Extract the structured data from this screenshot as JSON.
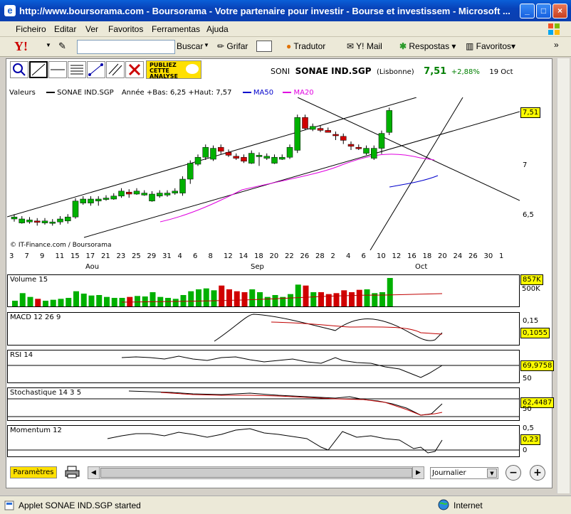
{
  "window": {
    "title": "http://www.boursorama.com - Boursorama - Votre partenaire pour investir - Bourse et investissem - Microsoft ..."
  },
  "menu": [
    "Ficheiro",
    "Editar",
    "Ver",
    "Favoritos",
    "Ferramentas",
    "Ajuda"
  ],
  "toolbar": {
    "search_label": "Buscar",
    "highlight_label": "Grifar",
    "translator_label": "Tradutor",
    "mail_label": "Y! Mail",
    "answers_label": "Respostas",
    "favorites_label": "Favoritos"
  },
  "ad": {
    "line1": "PUBLIEZ",
    "line2": "CETTE",
    "line3": "ANALYSE"
  },
  "quote": {
    "code": "SONI",
    "name": "SONAE IND.SGP",
    "market": "(Lisbonne)",
    "price": "7,51",
    "change": "+2,88%",
    "date": "19 Oct"
  },
  "chart": {
    "header": {
      "values_label": "Valeurs",
      "series_name": "SONAE IND.SGP",
      "range_text": "Année +Bas: 6,25 +Haut: 7,57",
      "ma50": "MA50",
      "ma20": "MA20"
    },
    "credit": "© IT-Finance.com / Boursorama",
    "price_labels": [
      "7,5",
      "7",
      "6,5"
    ],
    "last_price": "7,51",
    "x_days": [
      "3",
      "7",
      "9",
      "11",
      "15",
      "17",
      "21",
      "23",
      "25",
      "29",
      "31",
      "4",
      "6",
      "8",
      "12",
      "14",
      "18",
      "20",
      "22",
      "26",
      "28",
      "2",
      "4",
      "6",
      "10",
      "12",
      "16",
      "18",
      "20",
      "24",
      "26",
      "30",
      "1"
    ],
    "months": [
      "Aou",
      "Sep",
      "Oct"
    ],
    "colors": {
      "up": "#00b000",
      "down": "#d00000",
      "ma50": "#0000cc",
      "ma20": "#e000e0",
      "highlight": "#ffff00"
    },
    "candles": [
      [
        6.42,
        6.44,
        6.4
      ],
      [
        6.38,
        6.42,
        6.38
      ],
      [
        6.39,
        6.41,
        6.38
      ],
      [
        6.4,
        6.39,
        6.36
      ],
      [
        6.38,
        6.4,
        6.37
      ],
      [
        6.39,
        6.39,
        6.36
      ],
      [
        6.39,
        6.42,
        6.37
      ],
      [
        6.4,
        6.44,
        6.38
      ],
      [
        6.44,
        6.6,
        6.43
      ],
      [
        6.58,
        6.62,
        6.57
      ],
      [
        6.58,
        6.62,
        6.56
      ],
      [
        6.6,
        6.62,
        6.56
      ],
      [
        6.62,
        6.63,
        6.61
      ],
      [
        6.62,
        6.65,
        6.62
      ],
      [
        6.65,
        6.7,
        6.64
      ],
      [
        6.69,
        6.67,
        6.64
      ],
      [
        6.67,
        6.7,
        6.67
      ],
      [
        6.66,
        6.68,
        6.66
      ],
      [
        6.6,
        6.67,
        6.6
      ],
      [
        6.65,
        6.68,
        6.64
      ],
      [
        6.66,
        6.68,
        6.65
      ],
      [
        6.68,
        6.7,
        6.67
      ],
      [
        6.68,
        6.82,
        6.66
      ],
      [
        6.82,
        6.98,
        6.78
      ],
      [
        6.97,
        7.04,
        6.96
      ],
      [
        7.04,
        7.14,
        7.02
      ],
      [
        7.02,
        7.13,
        7.01
      ],
      [
        7.14,
        7.1,
        7.08
      ],
      [
        7.09,
        7.06,
        7.05
      ],
      [
        7.05,
        7.03,
        7.02
      ],
      [
        7.04,
        7.0,
        6.99
      ],
      [
        6.98,
        7.08,
        6.98
      ],
      [
        7.06,
        7.06,
        6.96
      ],
      [
        7.03,
        7.05,
        7.02
      ],
      [
        6.98,
        7.04,
        6.98
      ],
      [
        7.02,
        7.04,
        7.02
      ],
      [
        7.04,
        7.14,
        7.03
      ],
      [
        7.11,
        7.44,
        7.09
      ],
      [
        7.44,
        7.33,
        7.32
      ],
      [
        7.32,
        7.35,
        7.31
      ],
      [
        7.33,
        7.31,
        7.3
      ],
      [
        7.31,
        7.29,
        7.3
      ],
      [
        7.27,
        7.26,
        7.22
      ],
      [
        7.25,
        7.21,
        7.18
      ],
      [
        7.17,
        7.15,
        7.12
      ],
      [
        7.14,
        7.13,
        7.12
      ],
      [
        7.08,
        7.13,
        7.07
      ],
      [
        7.03,
        7.13,
        7.02
      ],
      [
        7.13,
        7.28,
        7.08
      ],
      [
        7.29,
        7.51,
        7.27
      ]
    ],
    "volume_labels": [
      "857K",
      "500K"
    ],
    "volumes": [
      120,
      280,
      200,
      160,
      120,
      140,
      160,
      180,
      320,
      270,
      230,
      240,
      200,
      180,
      180,
      200,
      220,
      210,
      300,
      200,
      180,
      160,
      240,
      320,
      360,
      380,
      340,
      440,
      360,
      320,
      300,
      360,
      300,
      200,
      240,
      200,
      260,
      460,
      440,
      300,
      300,
      260,
      280,
      340,
      300,
      350,
      360,
      280,
      300,
      600
    ],
    "macd": {
      "label": "MACD 12 26 9",
      "tick": "0,15",
      "value": "0,1055"
    },
    "rsi": {
      "label": "RSI 14",
      "tick": "50",
      "value": "69,9758"
    },
    "stoch": {
      "label": "Stochastique 14 3 5",
      "tick": "50",
      "value": "62,4487"
    },
    "momentum": {
      "label": "Momentum 12",
      "ticks": [
        "0,5",
        "0"
      ],
      "value": "0,23"
    }
  },
  "controls": {
    "params_label": "Paramètres",
    "period_value": "Journalier"
  },
  "status": {
    "text": "Applet SONAE IND.SGP started",
    "zone": "Internet"
  }
}
